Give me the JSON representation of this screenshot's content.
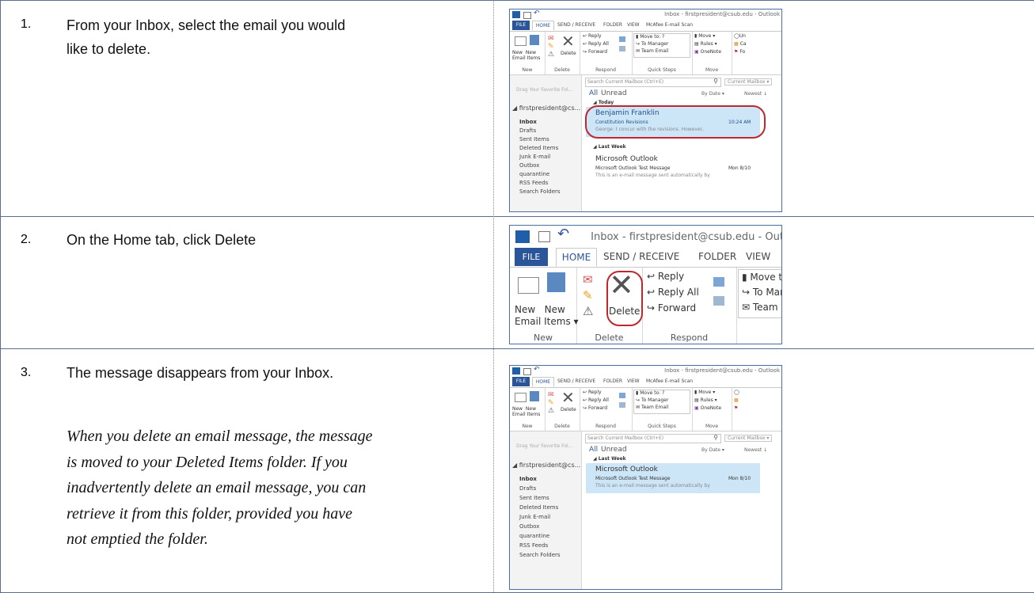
{
  "steps": [
    {
      "number": "1.",
      "text_line1": "From your Inbox, select the email you would",
      "text_line2": "like to delete."
    },
    {
      "number": "2.",
      "text_line1": "On the Home tab, click Delete"
    },
    {
      "number": "3.",
      "text_line1": "The message disappears from your Inbox.",
      "note_lines": [
        "When you delete an email message, the message",
        "is moved to your Deleted Items folder. If you",
        "inadvertently delete an email message, you can",
        "retrieve it from this folder, provided you have",
        "not emptied the folder."
      ]
    }
  ],
  "outlook": {
    "window_title": "Inbox - firstpresident@csub.edu - Outlook",
    "tabs": {
      "file": "FILE",
      "home": "HOME",
      "send_receive": "SEND / RECEIVE",
      "folder": "FOLDER",
      "view": "VIEW",
      "mcafee": "McAfee E-mail Scan"
    },
    "ribbon": {
      "new_email": "New Email",
      "new_email_1": "New",
      "new_email_2": "Email",
      "new_items_1": "New",
      "new_items_2": "Items",
      "delete": "Delete",
      "reply": "Reply",
      "reply_all": "Reply All",
      "forward": "Forward",
      "move_to": "Move to: ?",
      "to_manager": "To Manager",
      "team_email": "Team Email",
      "move": "Move",
      "rules": "Rules",
      "onenote": "OneNote",
      "unread_partial": "Un",
      "categorize_partial": "Ca",
      "followup_partial": "Fo",
      "group_new": "New",
      "group_delete": "Delete",
      "group_respond": "Respond",
      "group_quick_steps": "Quick Steps",
      "group_move": "Move"
    },
    "nav": {
      "drag_hint": "Drag Your Favorite Fol...",
      "account": "firstpresident@cs...",
      "folders": [
        "Inbox",
        "Drafts",
        "Sent Items",
        "Deleted Items",
        "Junk E-mail",
        "Outbox",
        "quarantine",
        "RSS Feeds",
        "Search Folders"
      ]
    },
    "search": {
      "placeholder": "Search Current Mailbox (Ctrl+E)",
      "scope": "Current Mailbox"
    },
    "filters": {
      "all": "All",
      "unread": "Unread",
      "by_date": "By Date",
      "newest": "Newest"
    },
    "groups": {
      "today": "Today",
      "last_week": "Last Week"
    },
    "emails": [
      {
        "sender": "Benjamin Franklin",
        "subject": "Constitution Revisions",
        "preview": "George: I concur with the revisions. However,",
        "time": "10:24 AM"
      },
      {
        "sender": "Microsoft Outlook",
        "subject": "Microsoft Outlook Test Message",
        "preview": "This is an e-mail message sent automatically by",
        "time": "Mon 8/10"
      }
    ]
  },
  "colors": {
    "file_tab": "#2a5699",
    "highlight_circle": "#c0272d",
    "selected_row": "#cde6f7",
    "border": "#4a6fa5"
  }
}
